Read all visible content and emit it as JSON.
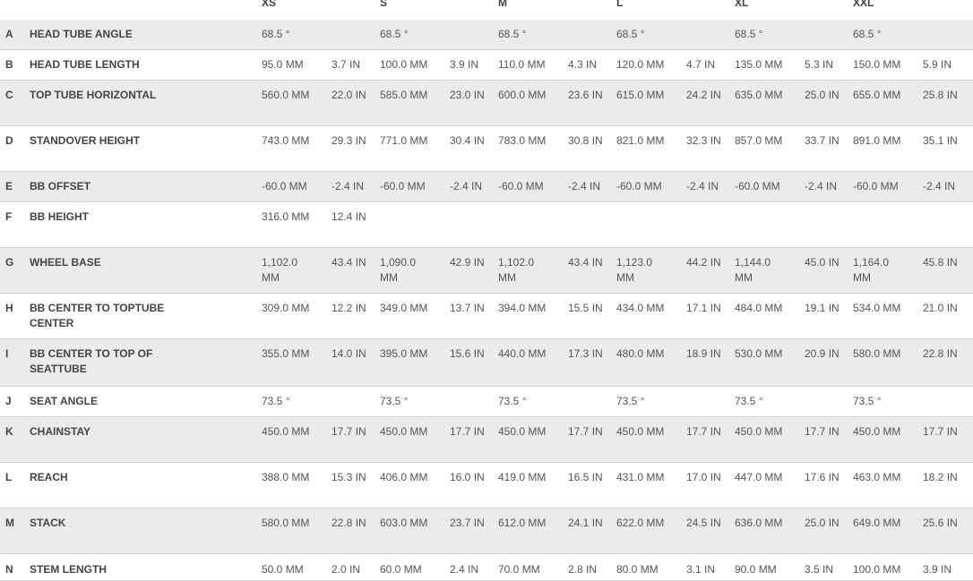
{
  "table": {
    "sizes": [
      "XS",
      "S",
      "M",
      "L",
      "XL",
      "XXL"
    ],
    "rows": [
      {
        "letter": "A",
        "label": "HEAD TUBE ANGLE",
        "values": [
          [
            "68.5 °",
            ""
          ],
          [
            "68.5 °",
            ""
          ],
          [
            "68.5 °",
            ""
          ],
          [
            "68.5 °",
            ""
          ],
          [
            "68.5 °",
            ""
          ],
          [
            "68.5 °",
            ""
          ]
        ]
      },
      {
        "letter": "B",
        "label": "HEAD TUBE LENGTH",
        "values": [
          [
            "95.0 MM",
            "3.7 IN"
          ],
          [
            "100.0 MM",
            "3.9 IN"
          ],
          [
            "110.0 MM",
            "4.3 IN"
          ],
          [
            "120.0 MM",
            "4.7 IN"
          ],
          [
            "135.0 MM",
            "5.3 IN"
          ],
          [
            "150.0 MM",
            "5.9 IN"
          ]
        ]
      },
      {
        "letter": "C",
        "label": "TOP TUBE HORIZONTAL",
        "values": [
          [
            "560.0 MM",
            "22.0 IN"
          ],
          [
            "585.0 MM",
            "23.0 IN"
          ],
          [
            "600.0 MM",
            "23.6 IN"
          ],
          [
            "615.0 MM",
            "24.2 IN"
          ],
          [
            "635.0 MM",
            "25.0 IN"
          ],
          [
            "655.0 MM",
            "25.8 IN"
          ]
        ]
      },
      {
        "letter": "D",
        "label": "STANDOVER HEIGHT",
        "values": [
          [
            "743.0 MM",
            "29.3 IN"
          ],
          [
            "771.0 MM",
            "30.4 IN"
          ],
          [
            "783.0 MM",
            "30.8 IN"
          ],
          [
            "821.0 MM",
            "32.3 IN"
          ],
          [
            "857.0 MM",
            "33.7 IN"
          ],
          [
            "891.0 MM",
            "35.1 IN"
          ]
        ]
      },
      {
        "letter": "E",
        "label": "BB OFFSET",
        "values": [
          [
            "-60.0 MM",
            "-2.4 IN"
          ],
          [
            "-60.0 MM",
            "-2.4 IN"
          ],
          [
            "-60.0 MM",
            "-2.4 IN"
          ],
          [
            "-60.0 MM",
            "-2.4 IN"
          ],
          [
            "-60.0 MM",
            "-2.4 IN"
          ],
          [
            "-60.0 MM",
            "-2.4 IN"
          ]
        ]
      },
      {
        "letter": "F",
        "label": "BB HEIGHT",
        "values": [
          [
            "316.0 MM",
            "12.4 IN"
          ],
          [
            "",
            ""
          ],
          [
            "",
            ""
          ],
          [
            "",
            ""
          ],
          [
            "",
            ""
          ],
          [
            "",
            ""
          ]
        ]
      },
      {
        "letter": "G",
        "label": "WHEEL BASE",
        "values": [
          [
            "1,102.0 MM",
            "43.4 IN"
          ],
          [
            "1,090.0 MM",
            "42.9 IN"
          ],
          [
            "1,102.0 MM",
            "43.4 IN"
          ],
          [
            "1,123.0 MM",
            "44.2 IN"
          ],
          [
            "1,144.0 MM",
            "45.0 IN"
          ],
          [
            "1,164.0 MM",
            "45.8 IN"
          ]
        ]
      },
      {
        "letter": "H",
        "label": "BB CENTER TO TOPTUBE CENTER",
        "values": [
          [
            "309.0 MM",
            "12.2 IN"
          ],
          [
            "349.0 MM",
            "13.7 IN"
          ],
          [
            "394.0 MM",
            "15.5 IN"
          ],
          [
            "434.0 MM",
            "17.1 IN"
          ],
          [
            "484.0 MM",
            "19.1 IN"
          ],
          [
            "534.0 MM",
            "21.0 IN"
          ]
        ]
      },
      {
        "letter": "I",
        "label": "BB CENTER TO TOP OF SEATTUBE",
        "values": [
          [
            "355.0 MM",
            "14.0 IN"
          ],
          [
            "395.0 MM",
            "15.6 IN"
          ],
          [
            "440.0 MM",
            "17.3 IN"
          ],
          [
            "480.0 MM",
            "18.9 IN"
          ],
          [
            "530.0 MM",
            "20.9 IN"
          ],
          [
            "580.0 MM",
            "22.8 IN"
          ]
        ]
      },
      {
        "letter": "J",
        "label": "SEAT ANGLE",
        "values": [
          [
            "73.5 °",
            ""
          ],
          [
            "73.5 °",
            ""
          ],
          [
            "73.5 °",
            ""
          ],
          [
            "73.5 °",
            ""
          ],
          [
            "73.5 °",
            ""
          ],
          [
            "73.5 °",
            ""
          ]
        ]
      },
      {
        "letter": "K",
        "label": "CHAINSTAY",
        "values": [
          [
            "450.0 MM",
            "17.7 IN"
          ],
          [
            "450.0 MM",
            "17.7 IN"
          ],
          [
            "450.0 MM",
            "17.7 IN"
          ],
          [
            "450.0 MM",
            "17.7 IN"
          ],
          [
            "450.0 MM",
            "17.7 IN"
          ],
          [
            "450.0 MM",
            "17.7 IN"
          ]
        ]
      },
      {
        "letter": "L",
        "label": "REACH",
        "values": [
          [
            "388.0 MM",
            "15.3 IN"
          ],
          [
            "406.0 MM",
            "16.0 IN"
          ],
          [
            "419.0 MM",
            "16.5 IN"
          ],
          [
            "431.0 MM",
            "17.0 IN"
          ],
          [
            "447.0 MM",
            "17.6 IN"
          ],
          [
            "463.0 MM",
            "18.2 IN"
          ]
        ]
      },
      {
        "letter": "M",
        "label": "STACK",
        "values": [
          [
            "580.0 MM",
            "22.8 IN"
          ],
          [
            "603.0 MM",
            "23.7 IN"
          ],
          [
            "612.0 MM",
            "24.1 IN"
          ],
          [
            "622.0 MM",
            "24.5 IN"
          ],
          [
            "636.0 MM",
            "25.0 IN"
          ],
          [
            "649.0 MM",
            "25.6 IN"
          ]
        ]
      },
      {
        "letter": "N",
        "label": "STEM LENGTH",
        "values": [
          [
            "50.0 MM",
            "2.0 IN"
          ],
          [
            "60.0 MM",
            "2.4 IN"
          ],
          [
            "70.0 MM",
            "2.8 IN"
          ],
          [
            "80.0 MM",
            "3.1 IN"
          ],
          [
            "90.0 MM",
            "3.5 IN"
          ],
          [
            "100.0 MM",
            "3.9 IN"
          ]
        ]
      }
    ]
  }
}
